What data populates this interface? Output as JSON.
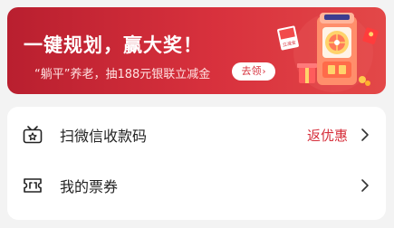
{
  "banner": {
    "title": "一键规划，赢大奖！",
    "subtitle": "“躺平”养老，抽188元银联立减金",
    "cta_label": "去领",
    "cta_icon": "chevron-right-icon",
    "illustration_badge": "立减金",
    "colors": {
      "start": "#b91f2f",
      "end": "#e34848",
      "accent": "#d6303c"
    }
  },
  "menu": {
    "items": [
      {
        "label": "扫微信收款码",
        "badge": "返优惠",
        "icon": "scan-register-icon",
        "chevron": "chevron-right-icon"
      },
      {
        "label": "我的票券",
        "icon": "ticket-icon",
        "chevron": "chevron-right-icon"
      }
    ]
  }
}
